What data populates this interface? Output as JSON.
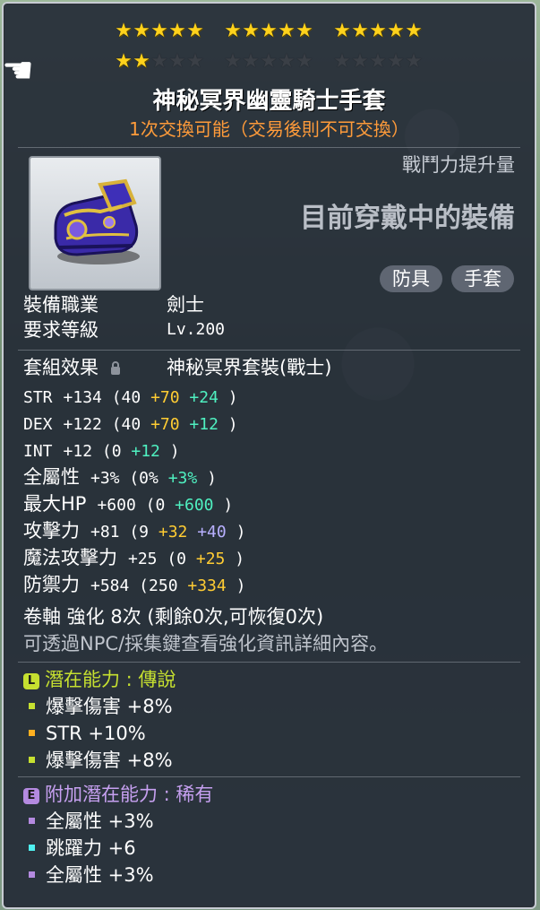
{
  "stars": {
    "rows": [
      [
        [
          1,
          1,
          1,
          1,
          1
        ],
        [
          1,
          1,
          1,
          1,
          1
        ],
        [
          1,
          1,
          1,
          1,
          1
        ]
      ],
      [
        [
          1,
          1,
          0,
          0,
          0
        ],
        [
          0,
          0,
          0,
          0,
          0
        ],
        [
          0,
          0,
          0,
          0,
          0
        ]
      ]
    ],
    "filled": 17,
    "total": 30
  },
  "item": {
    "name": "神秘冥界幽靈騎士手套",
    "trade_note": "1次交換可能（交易後則不可交換）"
  },
  "compare": {
    "power_label": "戰鬥力提升量",
    "equipped_label": "目前穿戴中的裝備"
  },
  "tags": [
    "防具",
    "手套"
  ],
  "requirements": [
    {
      "label": "裝備職業",
      "value": "劍士"
    },
    {
      "label": "要求等級",
      "value": "Lv.200"
    }
  ],
  "set_effect": {
    "label": "套組效果",
    "value": "神秘冥界套裝(戰士)",
    "lock_icon": "lock-icon"
  },
  "stats": [
    {
      "label": "STR",
      "total": "+134",
      "open": "(40",
      "parts": [
        {
          "text": "+70",
          "color": "yellow"
        },
        {
          "text": "+24",
          "color": "cyan"
        }
      ],
      "close": ")"
    },
    {
      "label": "DEX",
      "total": "+122",
      "open": "(40",
      "parts": [
        {
          "text": "+70",
          "color": "yellow"
        },
        {
          "text": "+12",
          "color": "cyan"
        }
      ],
      "close": ")"
    },
    {
      "label": "INT",
      "total": "+12",
      "open": "(0",
      "parts": [
        {
          "text": "+12",
          "color": "cyan"
        }
      ],
      "close": ")"
    },
    {
      "label": "全屬性",
      "total": "+3%",
      "open": "(0%",
      "parts": [
        {
          "text": "+3%",
          "color": "cyan"
        }
      ],
      "close": ")"
    },
    {
      "label": "最大HP",
      "total": "+600",
      "open": "(0",
      "parts": [
        {
          "text": "+600",
          "color": "cyan"
        }
      ],
      "close": ")"
    },
    {
      "label": "攻擊力",
      "total": "+81",
      "open": "(9",
      "parts": [
        {
          "text": "+32",
          "color": "yellow"
        },
        {
          "text": "+40",
          "color": "purple"
        }
      ],
      "close": ")"
    },
    {
      "label": "魔法攻擊力",
      "total": "+25",
      "open": "(0",
      "parts": [
        {
          "text": "+25",
          "color": "yellow"
        }
      ],
      "close": ")"
    },
    {
      "label": "防禦力",
      "total": "+584",
      "open": "(250",
      "parts": [
        {
          "text": "+334",
          "color": "yellow"
        }
      ],
      "close": ")"
    }
  ],
  "scroll": {
    "line": "卷軸 強化 8次 (剩餘0次,可恢復0次)",
    "hint": "可透過NPC/採集鍵查看強化資訊詳細內容。"
  },
  "potential": {
    "badge": "L",
    "title": "潛在能力 : 傳說",
    "lines": [
      {
        "text": "爆擊傷害 +8%",
        "bullet": "#c6e030"
      },
      {
        "text": "STR +10%",
        "bullet": "#ffb020"
      },
      {
        "text": "爆擊傷害 +8%",
        "bullet": "#c6e030"
      }
    ]
  },
  "bonus_potential": {
    "badge": "E",
    "title": "附加潛在能力 : 稀有",
    "lines": [
      {
        "text": "全屬性 +3%",
        "bullet": "#b48ae0"
      },
      {
        "text": "跳躍力 +6",
        "bullet": "#4ff0f0"
      },
      {
        "text": "全屬性 +3%",
        "bullet": "#b48ae0"
      }
    ]
  },
  "colors": {
    "trade": "#ff9b3a",
    "yellow": "#ffcc33",
    "cyan": "#4ff0c0",
    "purple": "#b8b0ff"
  }
}
